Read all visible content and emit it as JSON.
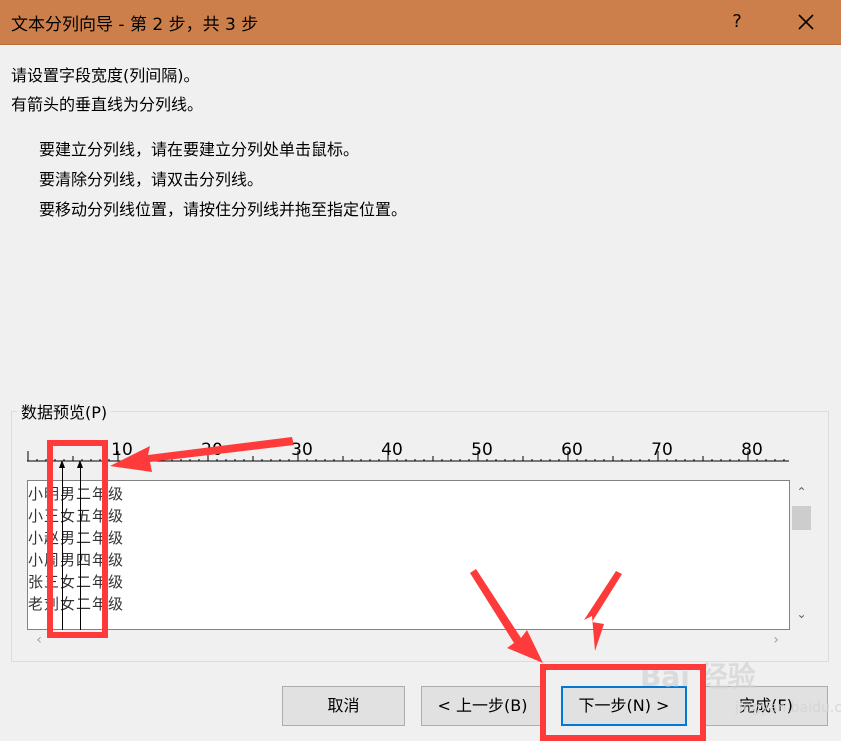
{
  "window": {
    "title": "文本分列向导 - 第 2 步，共 3 步",
    "help": "?",
    "title_bar_color": "#cd7f4b"
  },
  "instructions": {
    "line1": "请设置字段宽度(列间隔)。",
    "line2": "有箭头的垂直线为分列线。",
    "bullet1": "要建立分列线，请在要建立分列处单击鼠标。",
    "bullet2": "要清除分列线，请双击分列线。",
    "bullet3": "要移动分列线位置，请按住分列线并拖至指定位置。"
  },
  "preview": {
    "label": "数据预览(P)",
    "ruler_numbers": [
      "10",
      "20",
      "30",
      "40",
      "50",
      "60",
      "70",
      "80"
    ],
    "rows": [
      "小明男二年级",
      "小王女五年级",
      "小赵男二年级",
      "小周男四年级",
      "张三女二年级",
      "老刘女二年级"
    ]
  },
  "buttons": {
    "cancel": "取消",
    "back": "< 上一步(B)",
    "next": "下一步(N) >",
    "finish": "完成(F)"
  },
  "annotation_color": "#ff3a3a",
  "watermark": {
    "main": "Bai 经验",
    "sub": "jingyan.baidu.com"
  }
}
